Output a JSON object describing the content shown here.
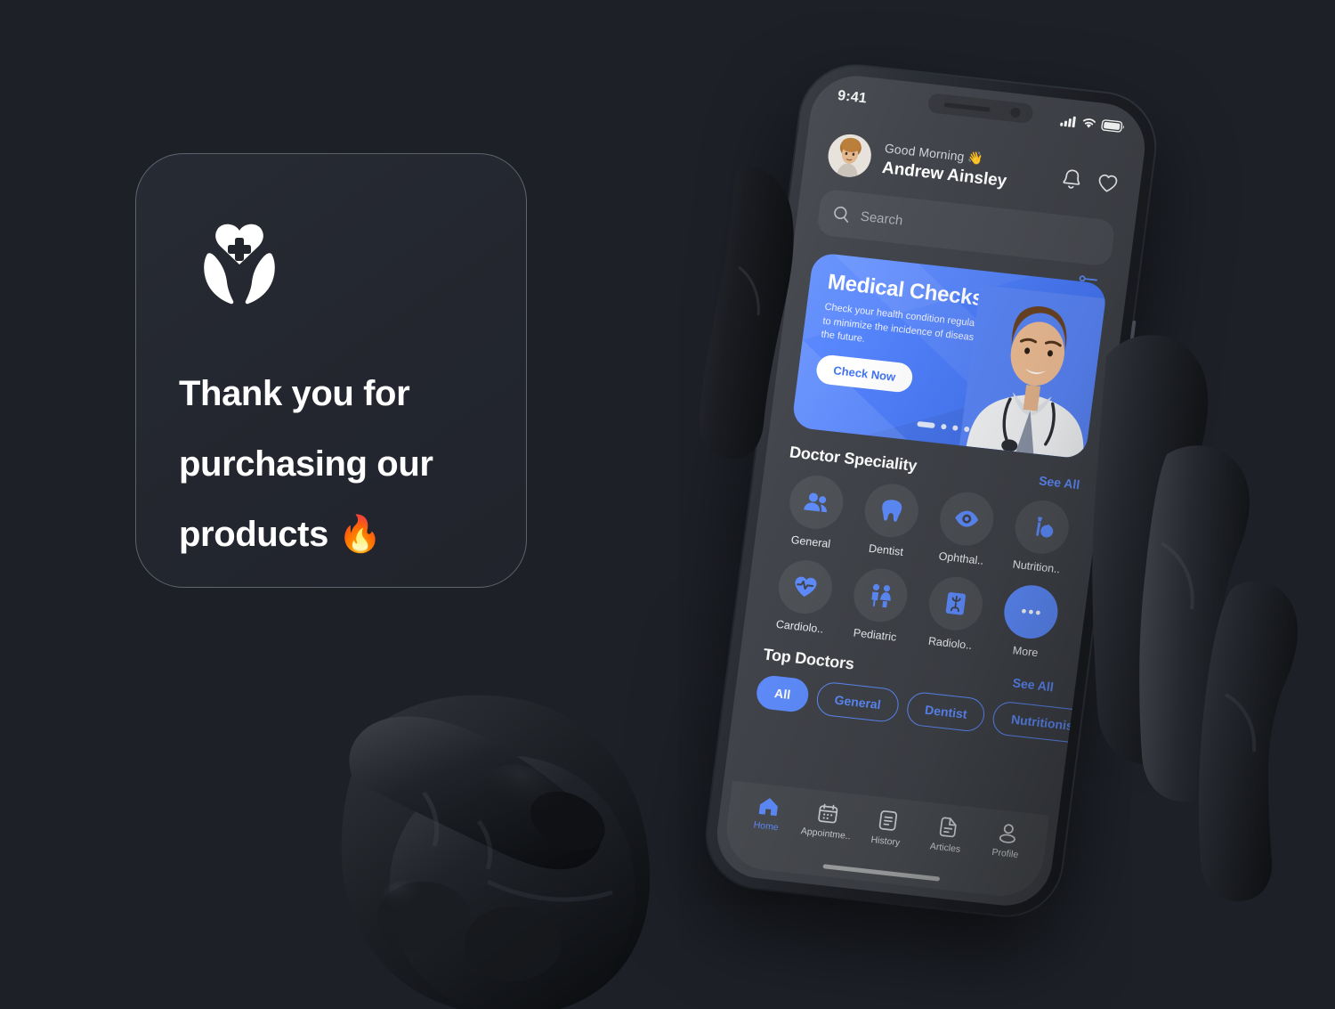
{
  "promo_card": {
    "logo_icon": "heart-in-hands-icon",
    "message": "Thank you for purchasing our products 🔥",
    "line1": "Thank you for",
    "line2": "purchasing our",
    "line3": "products 🔥"
  },
  "phone": {
    "status_bar": {
      "time": "9:41",
      "signal_icon": "cellular-signal-icon",
      "wifi_icon": "wifi-icon",
      "battery_icon": "battery-full-icon"
    },
    "header": {
      "avatar": "user-avatar",
      "greeting": "Good Morning 👋",
      "user_name": "Andrew Ainsley",
      "notification_icon": "bell-icon",
      "favorites_icon": "heart-outline-icon"
    },
    "search": {
      "placeholder": "Search",
      "search_icon": "search-icon",
      "filter_icon": "sliders-filter-icon"
    },
    "banner": {
      "title": "Medical Checks!",
      "subtitle": "Check your health condition regularly to minimize the incidence of disease in the future.",
      "cta_label": "Check Now",
      "image": "doctor-photo",
      "pagination": {
        "total": 4,
        "active_index": 0
      }
    },
    "speciality_section": {
      "title": "Doctor Speciality",
      "see_all_label": "See All",
      "items": [
        {
          "label": "General",
          "icon": "people-icon"
        },
        {
          "label": "Dentist",
          "icon": "tooth-icon"
        },
        {
          "label": "Ophthal..",
          "icon": "eye-icon"
        },
        {
          "label": "Nutrition..",
          "icon": "nutrition-icon"
        },
        {
          "label": "Cardiolo..",
          "icon": "heartbeat-icon"
        },
        {
          "label": "Pediatric",
          "icon": "children-icon"
        },
        {
          "label": "Radiolo..",
          "icon": "xray-icon"
        },
        {
          "label": "More",
          "icon": "more-dots-icon"
        }
      ]
    },
    "top_doctors_section": {
      "title": "Top Doctors",
      "see_all_label": "See All",
      "filters": [
        {
          "label": "All",
          "active": true
        },
        {
          "label": "General",
          "active": false
        },
        {
          "label": "Dentist",
          "active": false
        },
        {
          "label": "Nutritionist",
          "active": false
        }
      ]
    },
    "tab_bar": {
      "items": [
        {
          "label": "Home",
          "icon": "home-icon",
          "active": true
        },
        {
          "label": "Appointme..",
          "icon": "calendar-icon",
          "active": false
        },
        {
          "label": "History",
          "icon": "history-doc-icon",
          "active": false
        },
        {
          "label": "Articles",
          "icon": "article-doc-icon",
          "active": false
        },
        {
          "label": "Profile",
          "icon": "person-icon",
          "active": false
        }
      ]
    }
  },
  "colors": {
    "background": "#1d2027",
    "card": "#262a33",
    "screen": "#3f4248",
    "accent": "#5d8bfc",
    "text_primary": "#ffffff",
    "text_muted": "#a9acb2"
  }
}
